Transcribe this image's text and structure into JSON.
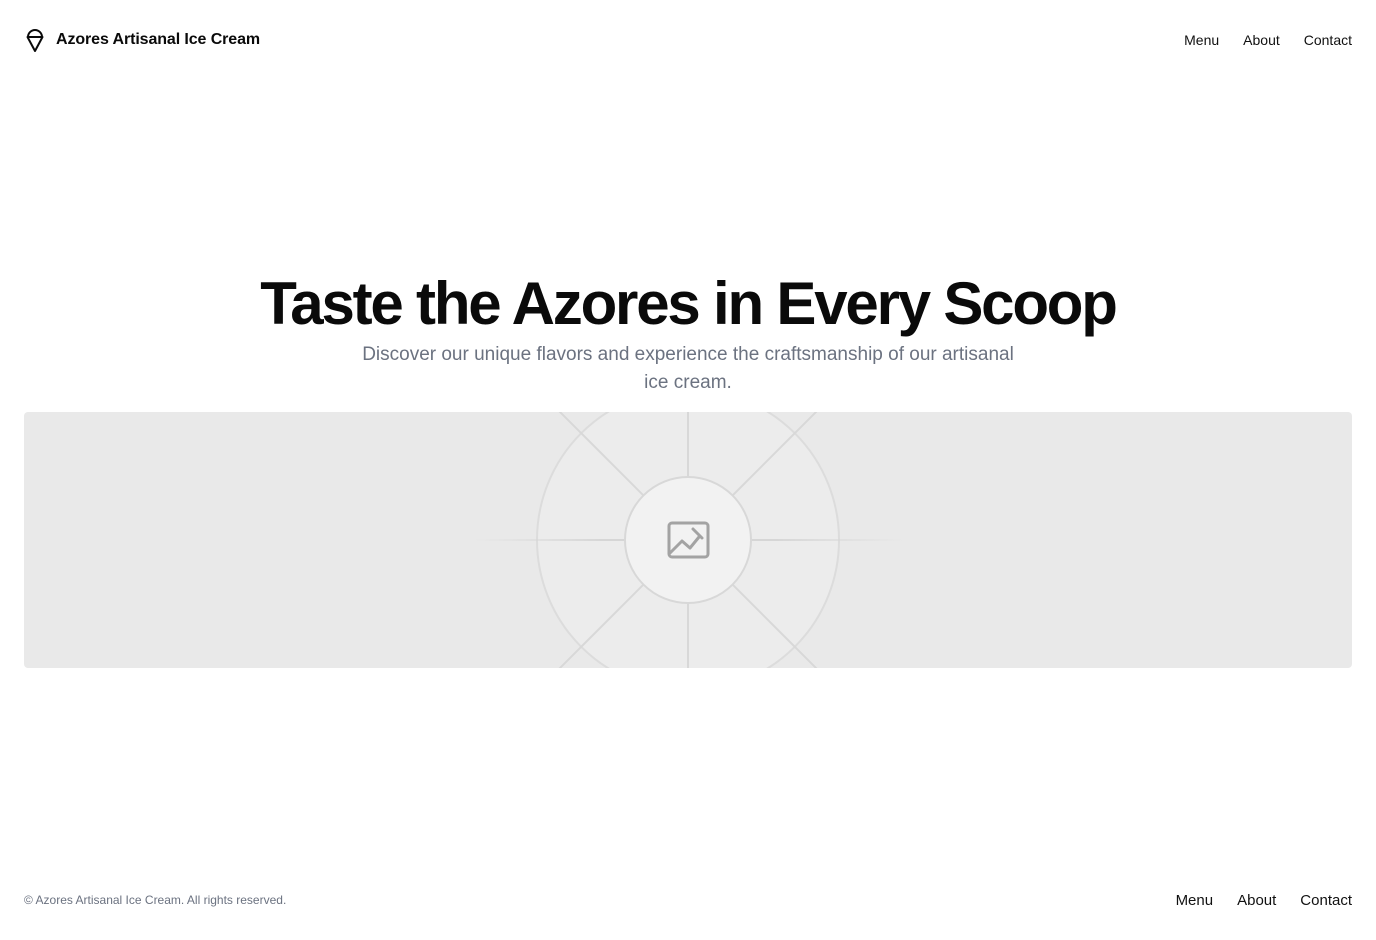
{
  "header": {
    "brand_name": "Azores Artisanal Ice Cream",
    "logo_icon": "ice-cream-cone-icon",
    "nav": [
      {
        "label": "Menu"
      },
      {
        "label": "About"
      },
      {
        "label": "Contact"
      }
    ]
  },
  "hero": {
    "title": "Taste the Azores in Every Scoop",
    "subtitle": "Discover our unique flavors and experience the craftsmanship of our artisanal ice cream.",
    "image_icon": "image-placeholder-icon"
  },
  "footer": {
    "copyright": "© Azores Artisanal Ice Cream. All rights reserved.",
    "nav": [
      {
        "label": "Menu"
      },
      {
        "label": "About"
      },
      {
        "label": "Contact"
      }
    ]
  },
  "colors": {
    "text": "#0a0a0a",
    "muted": "#6b7280",
    "placeholder_bg": "#e9e9e9"
  }
}
